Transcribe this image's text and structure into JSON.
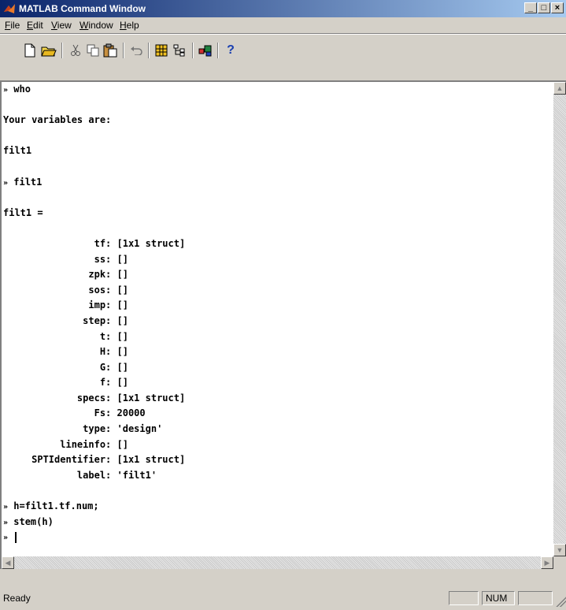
{
  "window": {
    "title": "MATLAB Command Window",
    "buttons": {
      "minimize": "_",
      "maximize": "□",
      "close": "×"
    }
  },
  "menu": [
    {
      "label": "File",
      "mnemonic": "F",
      "rest": "ile"
    },
    {
      "label": "Edit",
      "mnemonic": "E",
      "rest": "dit"
    },
    {
      "label": "View",
      "mnemonic": "V",
      "rest": "iew"
    },
    {
      "label": "Window",
      "mnemonic": "W",
      "rest": "indow"
    },
    {
      "label": "Help",
      "mnemonic": "H",
      "rest": "elp"
    }
  ],
  "toolbar": {
    "icons": [
      "new-file",
      "open-folder",
      "cut",
      "copy",
      "paste",
      "undo",
      "workspace-browser",
      "path-browser",
      "simulink",
      "help"
    ],
    "help_glyph": "?"
  },
  "console": {
    "prompt": "»",
    "lines": [
      {
        "type": "cmd",
        "text": "who"
      },
      {
        "type": "blank",
        "text": ""
      },
      {
        "type": "out",
        "text": "Your variables are:"
      },
      {
        "type": "blank",
        "text": ""
      },
      {
        "type": "out",
        "text": "filt1"
      },
      {
        "type": "blank",
        "text": ""
      },
      {
        "type": "cmd",
        "text": "filt1"
      },
      {
        "type": "blank",
        "text": ""
      },
      {
        "type": "out",
        "text": "filt1 ="
      },
      {
        "type": "blank",
        "text": ""
      },
      {
        "type": "out",
        "text": "                tf: [1x1 struct]"
      },
      {
        "type": "out",
        "text": "                ss: []"
      },
      {
        "type": "out",
        "text": "               zpk: []"
      },
      {
        "type": "out",
        "text": "               sos: []"
      },
      {
        "type": "out",
        "text": "               imp: []"
      },
      {
        "type": "out",
        "text": "              step: []"
      },
      {
        "type": "out",
        "text": "                 t: []"
      },
      {
        "type": "out",
        "text": "                 H: []"
      },
      {
        "type": "out",
        "text": "                 G: []"
      },
      {
        "type": "out",
        "text": "                 f: []"
      },
      {
        "type": "out",
        "text": "             specs: [1x1 struct]"
      },
      {
        "type": "out",
        "text": "                Fs: 20000"
      },
      {
        "type": "out",
        "text": "              type: 'design'"
      },
      {
        "type": "out",
        "text": "          lineinfo: []"
      },
      {
        "type": "out",
        "text": "     SPTIdentifier: [1x1 struct]"
      },
      {
        "type": "out",
        "text": "             label: 'filt1'"
      },
      {
        "type": "blank",
        "text": ""
      },
      {
        "type": "cmd",
        "text": "h=filt1.tf.num;"
      },
      {
        "type": "cmd",
        "text": "stem(h)"
      },
      {
        "type": "cursor",
        "text": ""
      }
    ]
  },
  "status": {
    "text": "Ready",
    "num": "NUM"
  },
  "colors": {
    "title_start": "#0a246a",
    "title_end": "#a6caf0",
    "chrome": "#d4d0c8"
  }
}
